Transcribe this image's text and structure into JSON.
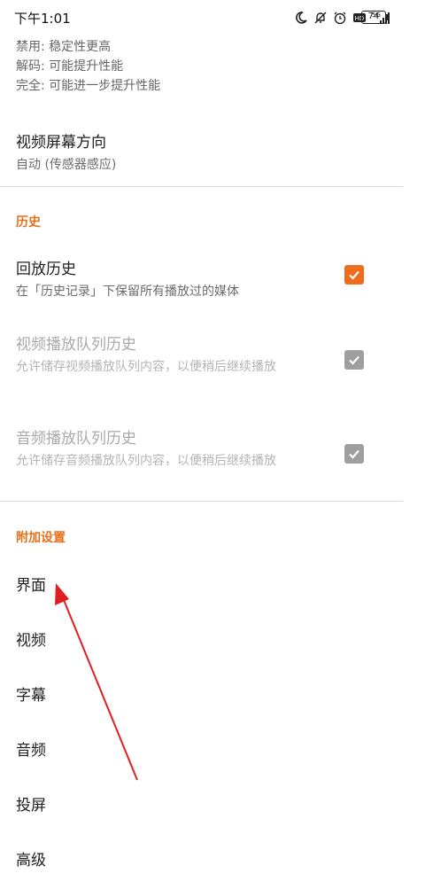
{
  "status_bar": {
    "time": "下午1:01",
    "network": "5G",
    "hd": "HD",
    "battery": "74"
  },
  "top_lines": [
    "禁用: 稳定性更高",
    "解码: 可能提升性能",
    "完全: 可能进一步提升性能"
  ],
  "orientation": {
    "title": "视频屏幕方向",
    "summary": "自动 (传感器感应)"
  },
  "history": {
    "category": "历史",
    "items": [
      {
        "title": "回放历史",
        "summary": "在「历史记录」下保留所有播放过的媒体",
        "checked": true,
        "enabled": true
      },
      {
        "title": "视频播放队列历史",
        "summary": "允许储存视频播放队列内容，以便稍后继续播放",
        "checked": true,
        "enabled": false
      },
      {
        "title": "音频播放队列历史",
        "summary": "允许储存音频播放队列内容，以便稍后继续播放",
        "checked": true,
        "enabled": false
      }
    ]
  },
  "extra": {
    "category": "附加设置",
    "items": [
      "界面",
      "视频",
      "字幕",
      "音频",
      "投屏",
      "高级"
    ]
  },
  "colors": {
    "accent": "#ef6c1c",
    "annotation_arrow": "#e02020"
  }
}
